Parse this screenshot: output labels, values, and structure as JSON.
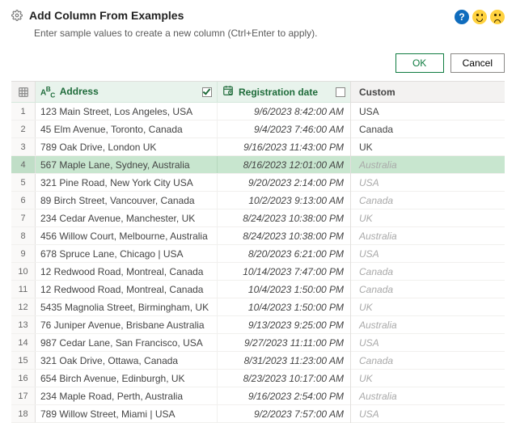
{
  "header": {
    "title": "Add Column From Examples",
    "subtitle": "Enter sample values to create a new column (Ctrl+Enter to apply)."
  },
  "buttons": {
    "ok": "OK",
    "cancel": "Cancel"
  },
  "columns": {
    "address_label": "Address",
    "date_label": "Registration date",
    "custom_label": "Custom",
    "address_checked": true,
    "date_checked": false
  },
  "selected_row_index": 3,
  "rows": [
    {
      "n": "1",
      "addr": "123 Main Street, Los Angeles, USA",
      "date": "9/6/2023 8:42:00 AM",
      "custom": "USA",
      "suggested": false
    },
    {
      "n": "2",
      "addr": "45 Elm Avenue, Toronto, Canada",
      "date": "9/4/2023 7:46:00 AM",
      "custom": "Canada",
      "suggested": false
    },
    {
      "n": "3",
      "addr": "789 Oak Drive, London UK",
      "date": "9/16/2023 11:43:00 PM",
      "custom": "UK",
      "suggested": false
    },
    {
      "n": "4",
      "addr": "567 Maple Lane, Sydney, Australia",
      "date": "8/16/2023 12:01:00 AM",
      "custom": "Australia",
      "suggested": true
    },
    {
      "n": "5",
      "addr": "321 Pine Road, New York City USA",
      "date": "9/20/2023 2:14:00 PM",
      "custom": "USA",
      "suggested": true
    },
    {
      "n": "6",
      "addr": "89 Birch Street, Vancouver, Canada",
      "date": "10/2/2023 9:13:00 AM",
      "custom": "Canada",
      "suggested": true
    },
    {
      "n": "7",
      "addr": "234 Cedar Avenue, Manchester, UK",
      "date": "8/24/2023 10:38:00 PM",
      "custom": "UK",
      "suggested": true
    },
    {
      "n": "8",
      "addr": "456 Willow Court, Melbourne, Australia",
      "date": "8/24/2023 10:38:00 PM",
      "custom": "Australia",
      "suggested": true
    },
    {
      "n": "9",
      "addr": "678 Spruce Lane, Chicago | USA",
      "date": "8/20/2023 6:21:00 PM",
      "custom": "USA",
      "suggested": true
    },
    {
      "n": "10",
      "addr": "12 Redwood Road, Montreal, Canada",
      "date": "10/14/2023 7:47:00 PM",
      "custom": "Canada",
      "suggested": true
    },
    {
      "n": "11",
      "addr": "12 Redwood Road, Montreal, Canada",
      "date": "10/4/2023 1:50:00 PM",
      "custom": "Canada",
      "suggested": true
    },
    {
      "n": "12",
      "addr": "5435 Magnolia Street, Birmingham, UK",
      "date": "10/4/2023 1:50:00 PM",
      "custom": "UK",
      "suggested": true
    },
    {
      "n": "13",
      "addr": "76 Juniper Avenue, Brisbane Australia",
      "date": "9/13/2023 9:25:00 PM",
      "custom": "Australia",
      "suggested": true
    },
    {
      "n": "14",
      "addr": "987 Cedar Lane, San Francisco, USA",
      "date": "9/27/2023 11:11:00 PM",
      "custom": "USA",
      "suggested": true
    },
    {
      "n": "15",
      "addr": "321 Oak Drive, Ottawa, Canada",
      "date": "8/31/2023 11:23:00 AM",
      "custom": "Canada",
      "suggested": true
    },
    {
      "n": "16",
      "addr": "654 Birch Avenue, Edinburgh, UK",
      "date": "8/23/2023 10:17:00 AM",
      "custom": "UK",
      "suggested": true
    },
    {
      "n": "17",
      "addr": "234 Maple Road, Perth, Australia",
      "date": "9/16/2023 2:54:00 PM",
      "custom": "Australia",
      "suggested": true
    },
    {
      "n": "18",
      "addr": "789 Willow Street, Miami | USA",
      "date": "9/2/2023 7:57:00 AM",
      "custom": "USA",
      "suggested": true
    }
  ]
}
